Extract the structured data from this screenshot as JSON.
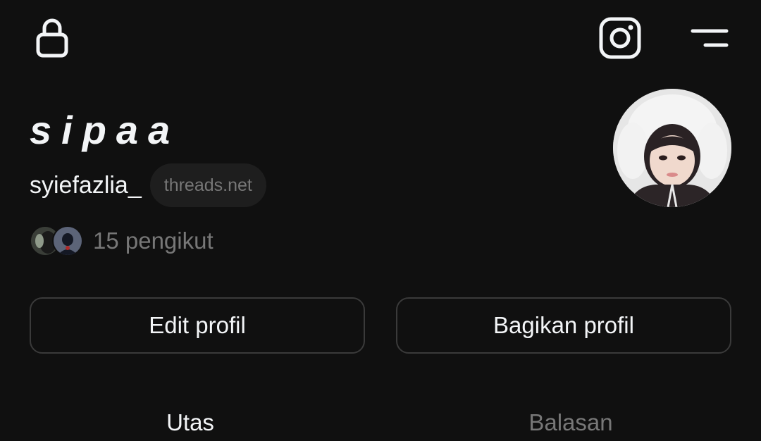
{
  "topbar": {
    "lock_icon": "lock-icon",
    "instagram_icon": "instagram-icon",
    "menu_icon": "menu-icon"
  },
  "profile": {
    "display_name": "sipaa",
    "username": "syiefazlia_",
    "domain": "threads.net",
    "followers_text": "15 pengikut"
  },
  "buttons": {
    "edit": "Edit profil",
    "share": "Bagikan profil"
  },
  "tabs": [
    {
      "label": "Utas",
      "active": true
    },
    {
      "label": "Balasan",
      "active": false
    }
  ],
  "colors": {
    "background": "#101010",
    "primary_text": "#f3f5f7",
    "secondary_text": "#777777",
    "border": "#3a3a3a",
    "badge_bg": "#1e1e1e"
  }
}
